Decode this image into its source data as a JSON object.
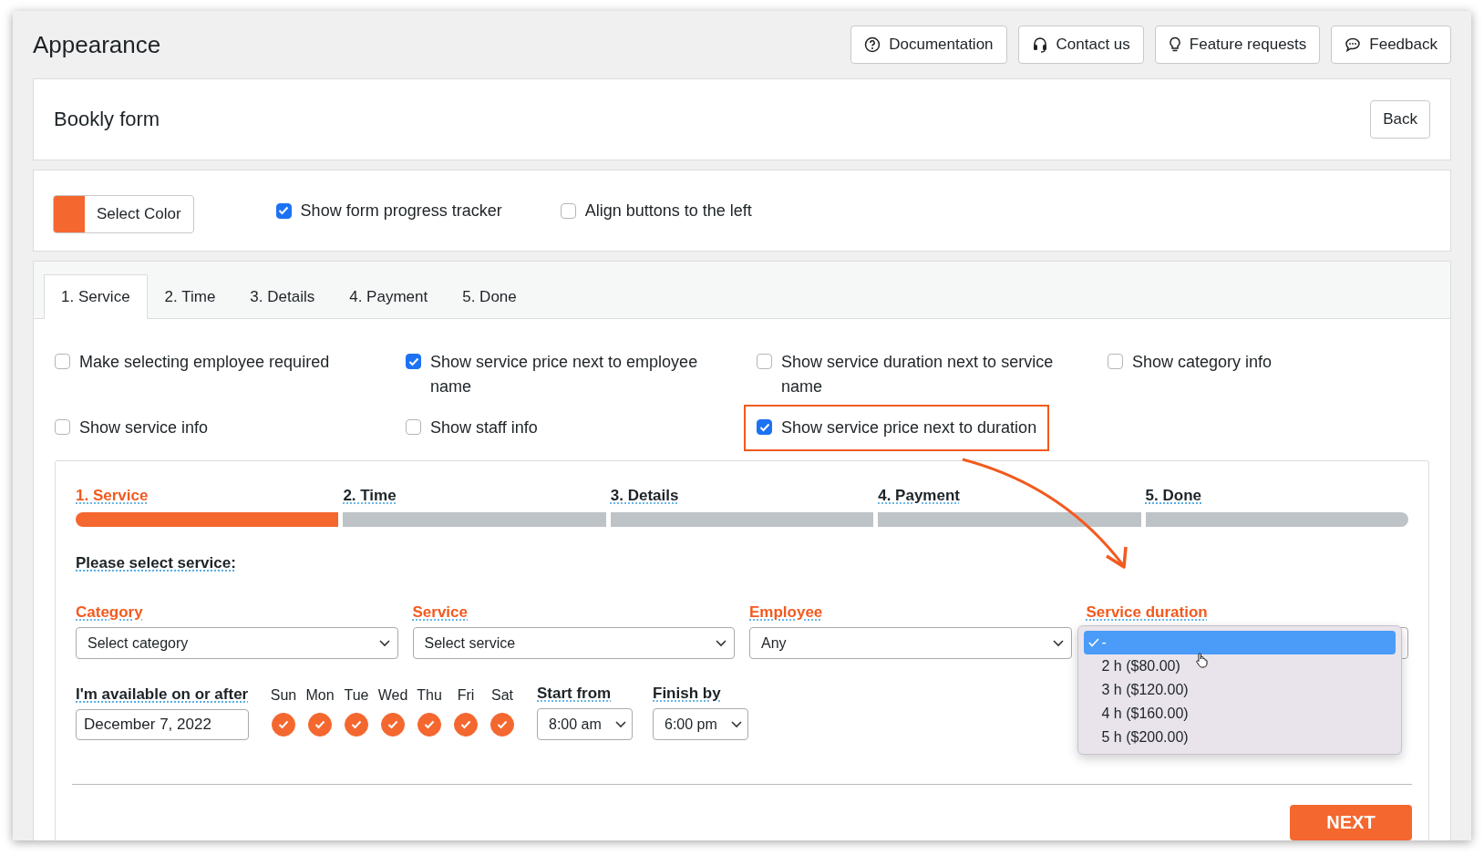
{
  "header": {
    "title": "Appearance",
    "buttons": [
      {
        "label": "Documentation",
        "kind": "help"
      },
      {
        "label": "Contact us",
        "kind": "headset"
      },
      {
        "label": "Feature requests",
        "kind": "bulb"
      },
      {
        "label": "Feedback",
        "kind": "chat"
      }
    ]
  },
  "form_card": {
    "title": "Bookly form",
    "back_button": "Back"
  },
  "settings": {
    "color_button": "Select Color",
    "color": "#f4672f",
    "options": [
      {
        "label": "Show form progress tracker",
        "checked": true
      },
      {
        "label": "Align buttons to the left",
        "checked": false
      }
    ]
  },
  "tabs": [
    {
      "label": "1. Service",
      "selected": true
    },
    {
      "label": "2. Time",
      "selected": false
    },
    {
      "label": "3. Details",
      "selected": false
    },
    {
      "label": "4. Payment",
      "selected": false
    },
    {
      "label": "5. Done",
      "selected": false
    }
  ],
  "service_options": [
    {
      "label": "Make selecting employee required",
      "checked": false,
      "highlighted": false
    },
    {
      "label": "Show service price next to employee name",
      "checked": true,
      "highlighted": false
    },
    {
      "label": "Show service duration next to service name",
      "checked": false,
      "highlighted": false
    },
    {
      "label": "Show category info",
      "checked": false,
      "highlighted": false
    },
    {
      "label": "Show service info",
      "checked": false,
      "highlighted": false
    },
    {
      "label": "Show staff info",
      "checked": false,
      "highlighted": false
    },
    {
      "label": "Show service price next to duration",
      "checked": true,
      "highlighted": true
    }
  ],
  "preview": {
    "steps": [
      {
        "label": "1. Service",
        "active": true
      },
      {
        "label": "2. Time",
        "active": false
      },
      {
        "label": "3. Details",
        "active": false
      },
      {
        "label": "4. Payment",
        "active": false
      },
      {
        "label": "5. Done",
        "active": false
      }
    ],
    "prompt": "Please select service:",
    "fields": [
      {
        "label": "Category",
        "value": "Select category"
      },
      {
        "label": "Service",
        "value": "Select service"
      },
      {
        "label": "Employee",
        "value": "Any"
      },
      {
        "label": "Service duration",
        "options": [
          {
            "label": "-",
            "selected": true
          },
          {
            "label": "2 h ($80.00)",
            "selected": false
          },
          {
            "label": "3 h ($120.00)",
            "selected": false
          },
          {
            "label": "4 h ($160.00)",
            "selected": false
          },
          {
            "label": "5 h ($200.00)",
            "selected": false
          }
        ]
      }
    ],
    "availability": {
      "label": "I'm available on or after",
      "date": "December 7, 2022",
      "days": [
        {
          "label": "Sun",
          "checked": true
        },
        {
          "label": "Mon",
          "checked": true
        },
        {
          "label": "Tue",
          "checked": true
        },
        {
          "label": "Wed",
          "checked": true
        },
        {
          "label": "Thu",
          "checked": true
        },
        {
          "label": "Fri",
          "checked": true
        },
        {
          "label": "Sat",
          "checked": true
        }
      ],
      "start": {
        "label": "Start from",
        "value": "8:00 am"
      },
      "finish": {
        "label": "Finish by",
        "value": "6:00 pm"
      }
    },
    "next_button": "NEXT"
  }
}
